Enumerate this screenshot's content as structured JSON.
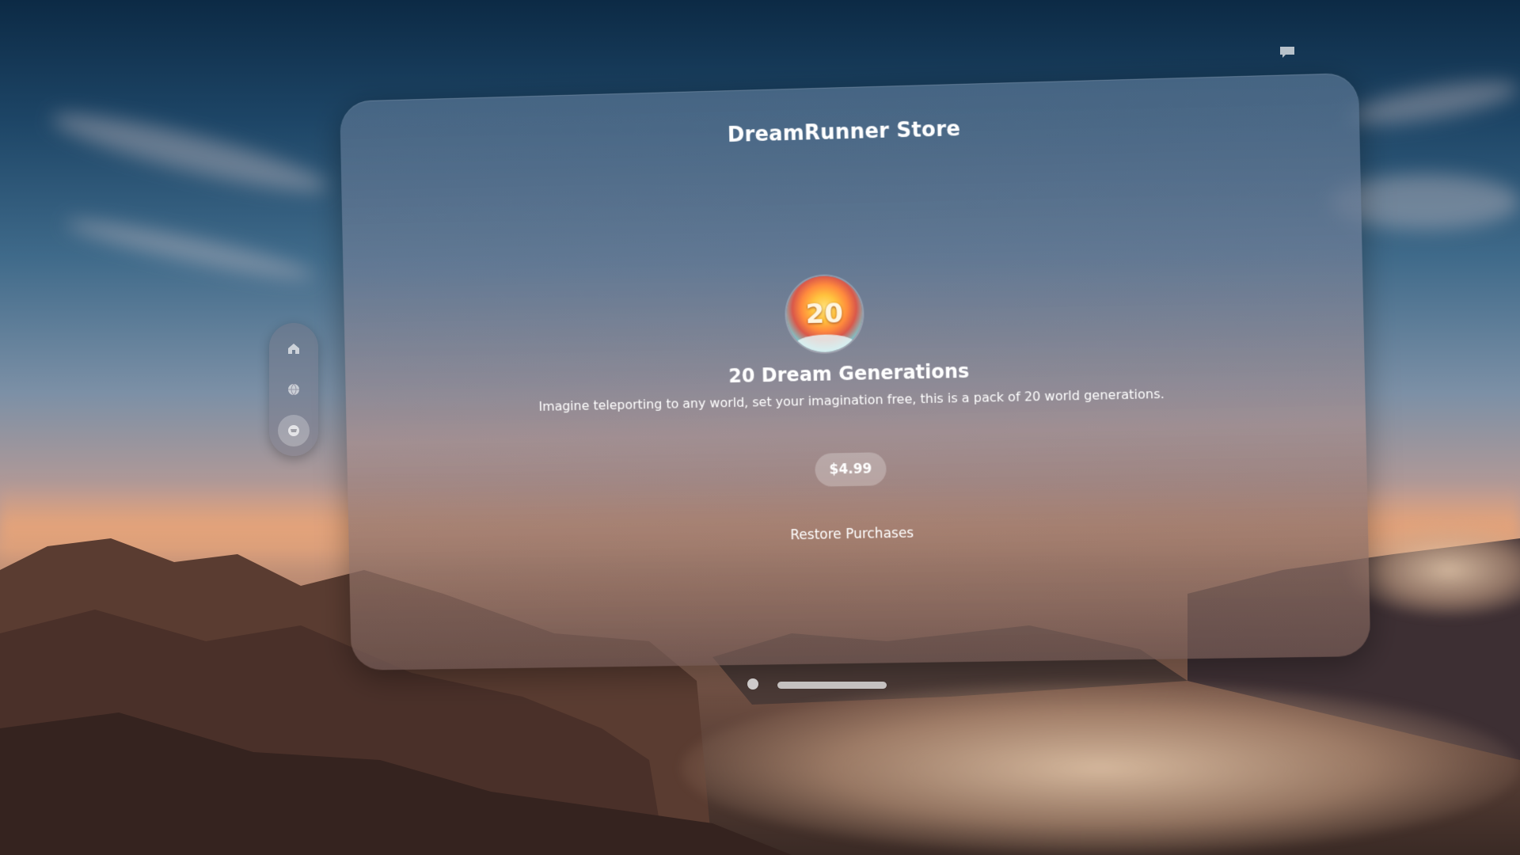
{
  "store": {
    "title": "DreamRunner Store"
  },
  "product": {
    "icon_label": "20",
    "icon_name": "dream-pack-badge",
    "name": "20 Dream Generations",
    "description": "Imagine teleporting to any world, set your imagination free, this is a pack of 20 world generations.",
    "price_label": "$4.99"
  },
  "actions": {
    "restore_label": "Restore Purchases"
  },
  "tabbar": {
    "items": [
      {
        "icon": "house-icon",
        "active": false
      },
      {
        "icon": "globe-icon",
        "active": false
      },
      {
        "icon": "cart-icon",
        "active": true
      }
    ]
  },
  "corner": {
    "icon": "chat-bubble-icon"
  },
  "colors": {
    "text": "#ffffff",
    "button_fill": "rgba(255,255,255,0.25)"
  }
}
